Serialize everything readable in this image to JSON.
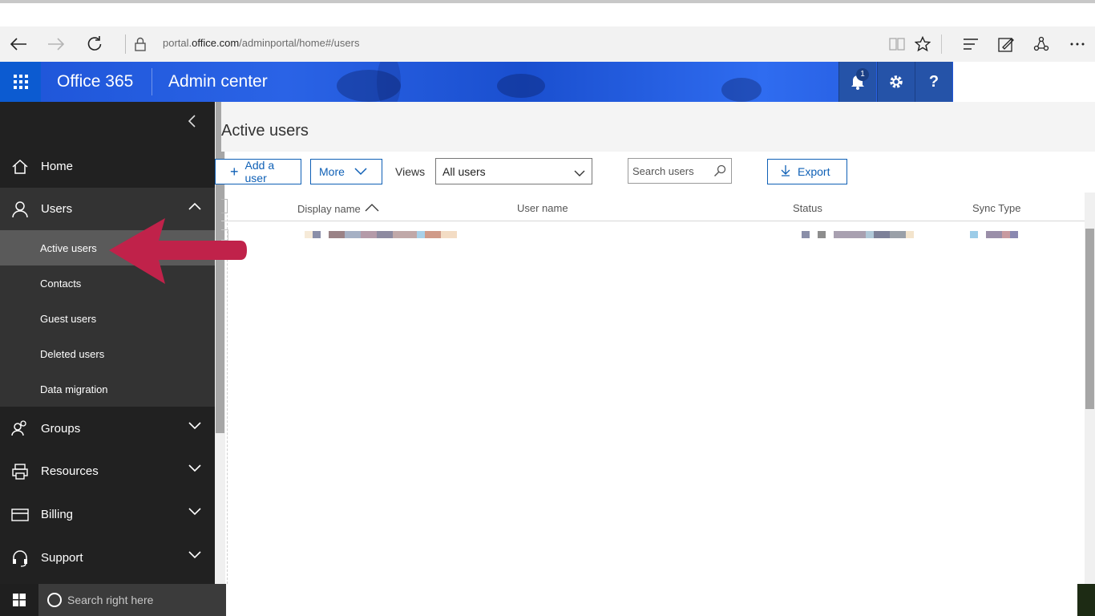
{
  "browser": {
    "url_prefix": "portal.",
    "url_domain": "office.com",
    "url_path": "/adminportal/home#/users"
  },
  "header": {
    "app_name": "Office 365",
    "section_name": "Admin center",
    "notification_count": "1",
    "help_label": "?"
  },
  "sidebar": {
    "items": [
      {
        "label": "Home"
      },
      {
        "label": "Users"
      },
      {
        "label": "Groups"
      },
      {
        "label": "Resources"
      },
      {
        "label": "Billing"
      },
      {
        "label": "Support"
      }
    ],
    "users_subitems": [
      {
        "label": "Active users"
      },
      {
        "label": "Contacts"
      },
      {
        "label": "Guest users"
      },
      {
        "label": "Deleted users"
      },
      {
        "label": "Data migration"
      }
    ]
  },
  "main": {
    "title": "Active users",
    "add_user_label": "Add a user",
    "more_label": "More",
    "views_label": "Views",
    "views_selected": "All users",
    "search_placeholder": "Search users",
    "export_label": "Export",
    "columns": [
      "Display name",
      "User name",
      "Status",
      "Sync Type"
    ]
  },
  "taskbar": {
    "search_placeholder": "Search right here"
  },
  "colors": {
    "accent": "#0f60b6",
    "header_blue": "#2a63e6",
    "sidebar_bg": "#212121",
    "arrow": "#c0224a"
  }
}
